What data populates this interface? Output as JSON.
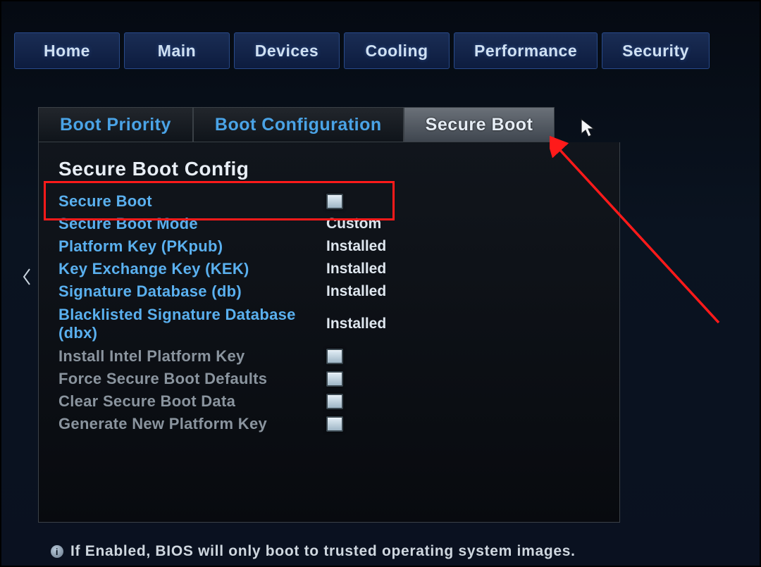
{
  "top_nav": {
    "tabs": [
      "Home",
      "Main",
      "Devices",
      "Cooling",
      "Performance",
      "Security"
    ]
  },
  "sub_nav": {
    "tabs": [
      "Boot Priority",
      "Boot Configuration",
      "Secure Boot"
    ],
    "active_index": 2
  },
  "panel": {
    "title": "Secure Boot Config",
    "rows": [
      {
        "label": "Secure Boot",
        "kind": "checkbox",
        "checked": false,
        "tone": "bright"
      },
      {
        "label": "Secure Boot Mode",
        "kind": "value",
        "value": "Custom",
        "tone": "bright"
      },
      {
        "label": "Platform Key (PKpub)",
        "kind": "value",
        "value": "Installed",
        "tone": "bright"
      },
      {
        "label": "Key Exchange Key (KEK)",
        "kind": "value",
        "value": "Installed",
        "tone": "bright"
      },
      {
        "label": "Signature Database (db)",
        "kind": "value",
        "value": "Installed",
        "tone": "bright"
      },
      {
        "label": "Blacklisted Signature Database (dbx)",
        "kind": "value",
        "value": "Installed",
        "tone": "bright",
        "tall": true
      },
      {
        "label": "Install Intel Platform Key",
        "kind": "checkbox",
        "checked": false,
        "tone": "dim"
      },
      {
        "label": "Force Secure Boot Defaults",
        "kind": "checkbox",
        "checked": false,
        "tone": "dim"
      },
      {
        "label": "Clear Secure Boot Data",
        "kind": "checkbox",
        "checked": false,
        "tone": "dim"
      },
      {
        "label": "Generate New Platform Key",
        "kind": "checkbox",
        "checked": false,
        "tone": "dim"
      }
    ]
  },
  "help_text": "If Enabled, BIOS will only boot to trusted operating system images."
}
